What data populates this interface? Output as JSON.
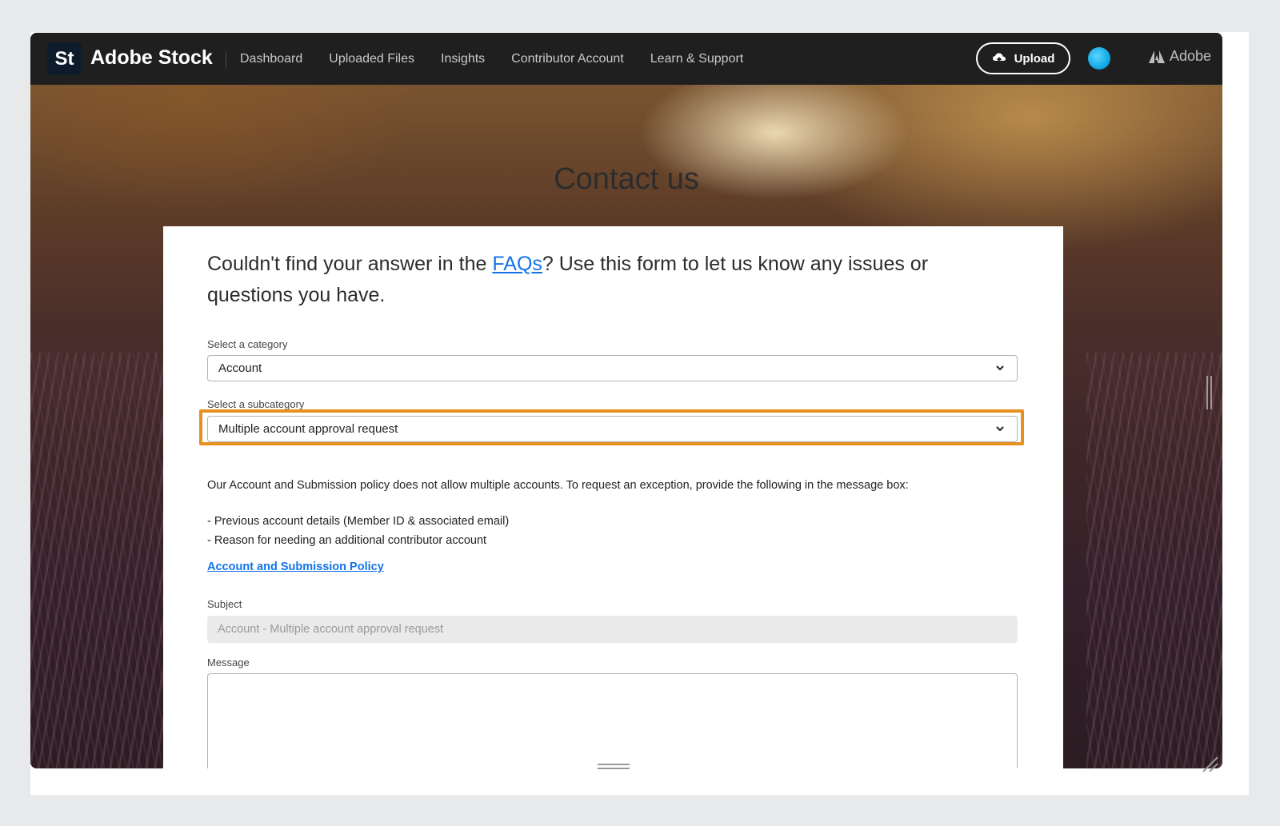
{
  "app": {
    "logo_text": "St",
    "brand_name": "Adobe Stock"
  },
  "nav": {
    "items": [
      {
        "label": "Dashboard"
      },
      {
        "label": "Uploaded Files"
      },
      {
        "label": "Insights"
      },
      {
        "label": "Contributor Account"
      },
      {
        "label": "Learn & Support"
      }
    ],
    "upload_label": "Upload",
    "adobe_label": "Adobe"
  },
  "page": {
    "title": "Contact us"
  },
  "intro": {
    "before": "Couldn't find your answer in the ",
    "link": "FAQs",
    "after": "? Use this form to let us know any issues or questions you have."
  },
  "form": {
    "category_label": "Select a category",
    "category_value": "Account",
    "subcategory_label": "Select a subcategory",
    "subcategory_value": "Multiple account approval request",
    "policy_line": "Our Account and Submission policy does not allow multiple accounts. To request an exception, provide the following in the message box:",
    "bullets": [
      "- Previous account details (Member ID & associated email)",
      "- Reason for needing an additional contributor account"
    ],
    "policy_link": "Account and Submission Policy",
    "subject_label": "Subject",
    "subject_placeholder": "Account - Multiple account approval request",
    "message_label": "Message",
    "message_value": ""
  },
  "colors": {
    "highlight": "#e8901e",
    "link": "#1473e6",
    "topbar": "#1f1f1f"
  }
}
